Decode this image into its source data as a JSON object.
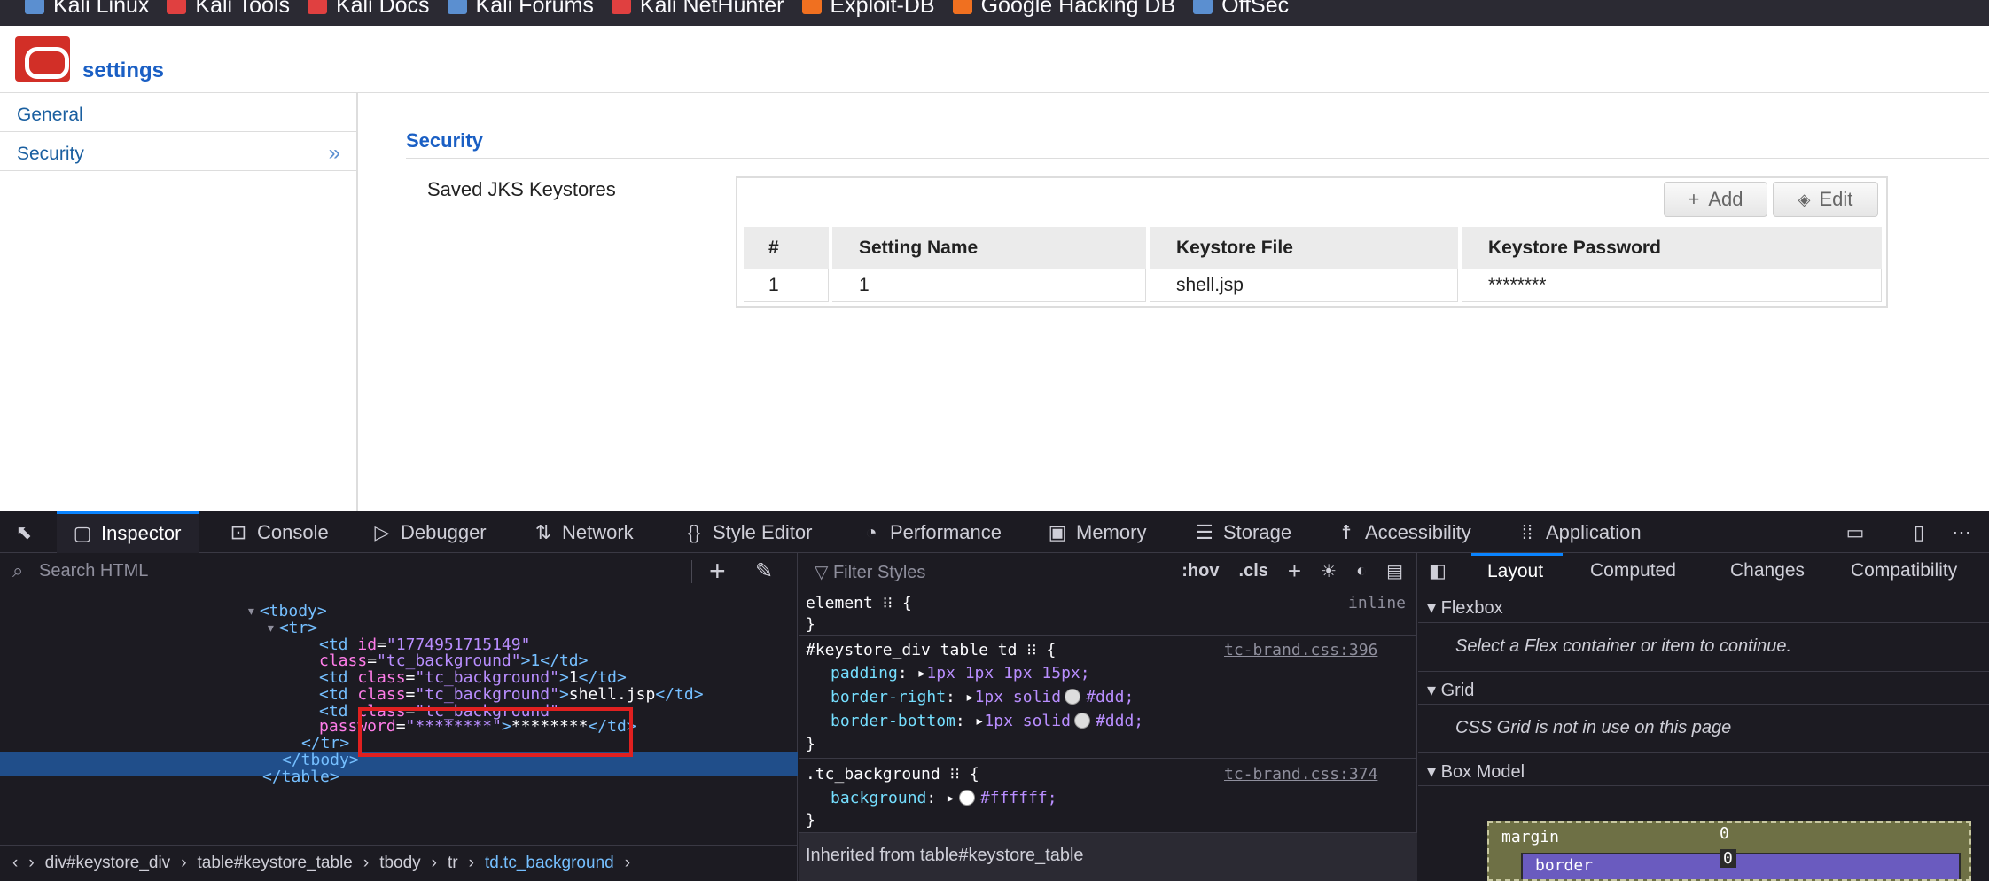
{
  "bookmarks": [
    {
      "label": "Kali Linux",
      "color": "#5b8fd0"
    },
    {
      "label": "Kali Tools",
      "color": "#e04040"
    },
    {
      "label": "Kali Docs",
      "color": "#e04040"
    },
    {
      "label": "Kali Forums",
      "color": "#5b8fd0"
    },
    {
      "label": "Kali NetHunter",
      "color": "#e04040"
    },
    {
      "label": "Exploit-DB",
      "color": "#f07020"
    },
    {
      "label": "Google Hacking DB",
      "color": "#f07020"
    },
    {
      "label": "OffSec",
      "color": "#5b8fd0"
    }
  ],
  "app": {
    "title": "settings",
    "brand_color": "#d22f27"
  },
  "sidebar": {
    "items": [
      {
        "label": "General"
      },
      {
        "label": "Security",
        "chevron": "»"
      }
    ]
  },
  "section": {
    "title": "Security"
  },
  "keystores": {
    "label": "Saved JKS Keystores",
    "add_label": "Add",
    "edit_label": "Edit",
    "headers": [
      "#",
      "Setting Name",
      "Keystore File",
      "Keystore Password"
    ],
    "rows": [
      [
        "1",
        "1",
        "shell.jsp",
        "********"
      ]
    ]
  },
  "devtools": {
    "tabs": [
      "Inspector",
      "Console",
      "Debugger",
      "Network",
      "Style Editor",
      "Performance",
      "Memory",
      "Storage",
      "Accessibility",
      "Application"
    ],
    "active_tab": "Inspector",
    "search_placeholder": "Search HTML",
    "filter_placeholder": "Filter Styles",
    "filter_buttons": [
      ":hov",
      ".cls"
    ],
    "html_lines": [
      {
        "t": "tag",
        "text": "<tbody>"
      },
      {
        "t": "tag",
        "text": "<tr>"
      },
      {
        "parts": [
          [
            "tag",
            "<td "
          ],
          [
            "attr",
            "id"
          ],
          [
            "txt",
            "="
          ],
          [
            "val",
            "\"1774951715149\""
          ]
        ]
      },
      {
        "parts": [
          [
            "attr",
            "class"
          ],
          [
            "txt",
            "="
          ],
          [
            "val",
            "\"tc_background\""
          ],
          [
            "tag",
            ">1</td>"
          ]
        ]
      },
      {
        "parts": [
          [
            "tag",
            "<td "
          ],
          [
            "attr",
            "class"
          ],
          [
            "txt",
            "="
          ],
          [
            "val",
            "\"tc_background\""
          ],
          [
            "tag",
            ">"
          ],
          [
            "txt",
            "1"
          ],
          [
            "tag",
            "</td>"
          ]
        ]
      },
      {
        "parts": [
          [
            "tag",
            "<td "
          ],
          [
            "attr",
            "class"
          ],
          [
            "txt",
            "="
          ],
          [
            "val",
            "\"tc_background\""
          ],
          [
            "tag",
            ">"
          ],
          [
            "txt",
            "shell.jsp"
          ],
          [
            "tag",
            "</td>"
          ]
        ]
      },
      {
        "parts": [
          [
            "tag",
            "<td "
          ],
          [
            "attr",
            "class"
          ],
          [
            "txt",
            "="
          ],
          [
            "val",
            "\"tc_background\""
          ]
        ]
      },
      {
        "parts": [
          [
            "attr",
            "password"
          ],
          [
            "txt",
            "="
          ],
          [
            "val",
            "\"********\""
          ],
          [
            "tag",
            ">"
          ],
          [
            "txt",
            "********"
          ],
          [
            "tag",
            "</td>"
          ]
        ]
      },
      {
        "t": "tag",
        "text": "</tr>"
      },
      {
        "t": "tag",
        "text": "</tbody>"
      },
      {
        "t": "tag",
        "text": "</table>"
      }
    ],
    "breadcrumbs": [
      "div#keystore_div",
      "table#keystore_table",
      "tbody",
      "tr",
      "td.tc_background"
    ],
    "css_rules": {
      "element_selector": "element",
      "element_source": "inline",
      "rule1_selector": "#keystore_div table td",
      "rule1_source": "tc-brand.css:396",
      "rule1_props": [
        {
          "name": "padding",
          "value": "1px 1px 1px 15px;"
        },
        {
          "name": "border-right",
          "value": "1px solid",
          "color": "#ddd;"
        },
        {
          "name": "border-bottom",
          "value": "1px solid",
          "color": "#ddd;"
        }
      ],
      "rule2_selector": ".tc_background",
      "rule2_source": "tc-brand.css:374",
      "rule2_prop": {
        "name": "background",
        "color": "#ffffff;"
      },
      "inherited": "Inherited from table#keystore_table"
    },
    "layout_tabs": [
      "Layout",
      "Computed",
      "Changes",
      "Compatibility"
    ],
    "flexbox_title": "Flexbox",
    "flexbox_msg": "Select a Flex container or item to continue.",
    "grid_title": "Grid",
    "grid_msg": "CSS Grid is not in use on this page",
    "boxmodel_title": "Box Model",
    "boxmodel": {
      "margin_label": "margin",
      "margin_value": "0",
      "border_label": "border",
      "border_value": "0"
    }
  }
}
